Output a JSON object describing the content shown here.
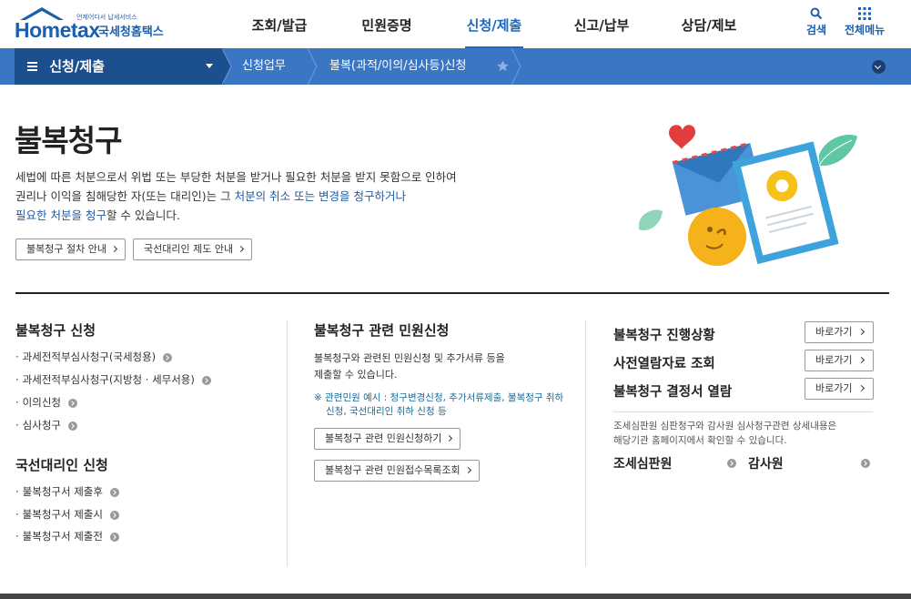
{
  "header": {
    "logo_tagline": "언제어디서 납세서비스",
    "logo_main": "Hometax",
    "logo_sub": "국세청홈택스",
    "gnb": [
      {
        "label": "조회/발급",
        "active": false
      },
      {
        "label": "민원증명",
        "active": false
      },
      {
        "label": "신청/제출",
        "active": true
      },
      {
        "label": "신고/납부",
        "active": false
      },
      {
        "label": "상담/제보",
        "active": false
      }
    ],
    "search_label": "검색",
    "allmenu_label": "전체메뉴",
    "accent_color": "#1d66c2"
  },
  "navbar": {
    "main_label": "신청/제출",
    "crumb1": "신청업무",
    "crumb2": "불복(과적/이의/심사등)신청"
  },
  "hero": {
    "title": "불복청구",
    "desc_line1": "세법에 따른 처분으로서 위법 또는 부당한 처분을 받거나 필요한 처분을 받지 못함으로 인하여",
    "desc_line2a": "권리나 이익을 침해당한 자(또는 대리인)는 그 ",
    "desc_line2b": "처분의 취소 또는 변경을 청구하거나",
    "desc_line3a": "필요한 처분을 청구",
    "desc_line3b": "할 수 있습니다.",
    "btn_procedure": "불복청구 절차 안내",
    "btn_agent": "국선대리인 제도 안내"
  },
  "col1": {
    "title": "불복청구 신청",
    "items": [
      "과세전적부심사청구(국세청용)",
      "과세전적부심사청구(지방청 · 세무서용)",
      "이의신청",
      "심사청구"
    ],
    "title2": "국선대리인 신청",
    "items2": [
      "불복청구서 제출후",
      "불복청구서 제출시",
      "불복청구서 제출전"
    ]
  },
  "col2": {
    "title": "불복청구 관련 민원신청",
    "text1": "불복청구와 관련된 민원신청 및 추가서류 등을",
    "text2": "제출할 수 있습니다.",
    "note1": "※ 관련민원 예시 : 청구변경신청, 추가서류제출, 불복청구 취하",
    "note2": "신청, 국선대리인 취하 신청 등",
    "btn1": "불복청구 관련 민원신청하기",
    "btn2": "불복청구 관련 민원접수목록조회"
  },
  "col3": {
    "rows": [
      {
        "title": "불복청구 진행상황",
        "btn": "바로가기"
      },
      {
        "title": "사전열람자료 조회",
        "btn": "바로가기"
      },
      {
        "title": "불복청구 결정서 열람",
        "btn": "바로가기"
      }
    ],
    "info1": "조세심판원 심판청구와 감사원 심사청구관련 상세내용은",
    "info2": "해당기관 홈페이지에서 확인할 수 있습니다.",
    "org1": "조세심판원",
    "org2": "감사원"
  }
}
